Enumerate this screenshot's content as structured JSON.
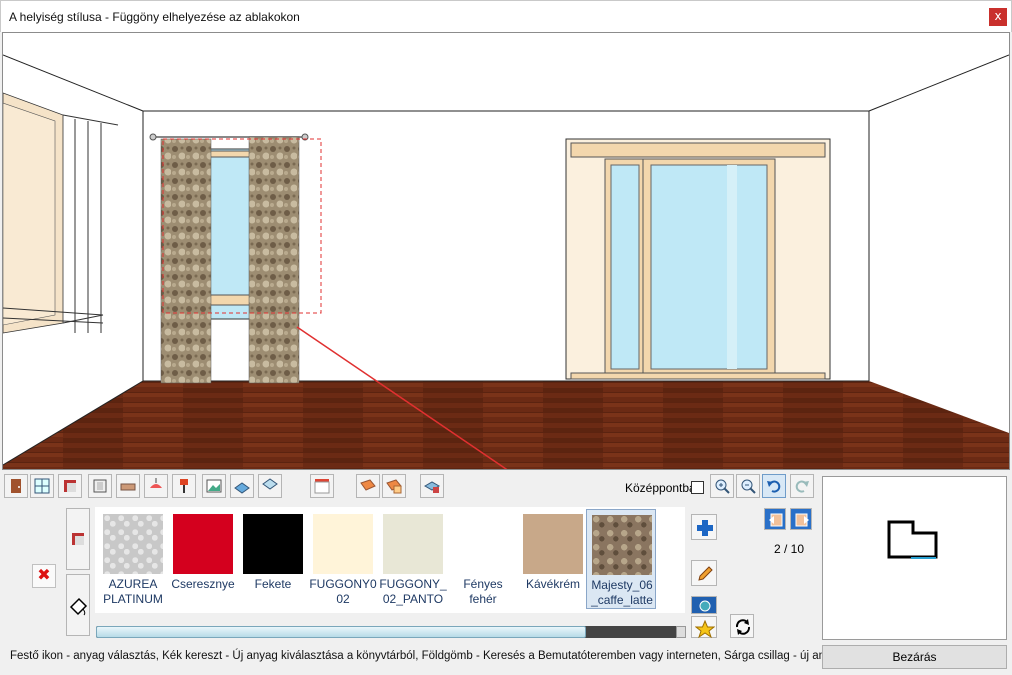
{
  "window": {
    "title": "A helyiség stílusa - Függöny elhelyezése az ablakokon",
    "close_glyph": "x"
  },
  "toolbar": {
    "icons": [
      "door-icon",
      "window-icon",
      "wall-paint-icon",
      "panel-icon",
      "bathtub-icon",
      "ceiling-lamp-icon",
      "floor-lamp-icon",
      "picture-icon",
      "floor-icon",
      "ceiling-icon",
      "curtain-icon",
      "wall-icon",
      "wall-tiles-icon",
      "room-icon"
    ],
    "center_label": "Középpontba",
    "center_checked": false,
    "view_buttons": [
      "zoom-in-icon",
      "zoom-out-icon",
      "undo-icon",
      "redo-icon"
    ]
  },
  "materials": {
    "items": [
      {
        "label": "AZUREA PLATINUM",
        "color": "#c8c8c8",
        "pattern": "damask-light"
      },
      {
        "label": "Cseresznye",
        "color": "#d4001e",
        "pattern": "solid"
      },
      {
        "label": "Fekete",
        "color": "#000000",
        "pattern": "solid"
      },
      {
        "label": "FUGGONY0 02",
        "color": "#fff4d9",
        "pattern": "solid"
      },
      {
        "label": "FUGGONY_ 02_PANTO",
        "color": "#e8e7d6",
        "pattern": "solid"
      },
      {
        "label": "Fényes fehér",
        "color": "#ffffff",
        "pattern": "solid"
      },
      {
        "label": "Kávékrém",
        "color": "#c8a889",
        "pattern": "solid"
      },
      {
        "label": "Majesty_06 _caffe_latte",
        "color": "#8a7560",
        "pattern": "damask",
        "selected": true
      }
    ],
    "scroll_fraction": 0.83
  },
  "pager": {
    "label": "2 / 10"
  },
  "status_text": "Festő ikon - anyag választás, Kék kereszt - Új anyag kiválasztása a könyvtárból, Földgömb - Keresés a Bemutatóteremben vagy interneten, Sárga csillag - új anyag",
  "close_button_label": "Bezárás",
  "colors": {
    "floor": "#6b2a14",
    "curtain": "#8f8068",
    "window_frame": "#f3d7ad",
    "glass": "#bfe8f6",
    "arrow": "#e03030"
  }
}
